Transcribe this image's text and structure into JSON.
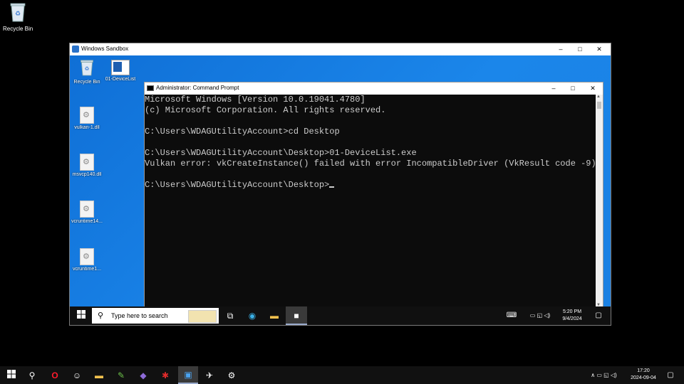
{
  "host_desktop": {
    "recycle_bin_label": "Recycle Bin"
  },
  "sandbox": {
    "title": "Windows Sandbox",
    "minimize": "–",
    "maximize": "□",
    "close": "✕",
    "icons": [
      "Recycle Bin",
      "01-DeviceList",
      "vulkan-1.dll",
      "msvcp140.dll",
      "vcruntime14...",
      "vcruntime1..."
    ]
  },
  "cmd": {
    "title": "Administrator: Command Prompt",
    "lines": [
      "Microsoft Windows [Version 10.0.19041.4780]",
      "(c) Microsoft Corporation. All rights reserved.",
      "",
      "C:\\Users\\WDAGUtilityAccount>cd Desktop",
      "",
      "C:\\Users\\WDAGUtilityAccount\\Desktop>01-DeviceList.exe",
      "Vulkan error: vkCreateInstance() failed with error IncompatibleDriver (VkResult code -9).",
      "",
      "C:\\Users\\WDAGUtilityAccount\\Desktop>"
    ]
  },
  "sandbox_taskbar": {
    "search_placeholder": "Type here to search",
    "time": "5:20 PM",
    "date": "9/4/2024"
  },
  "host_taskbar": {
    "time": "17:20",
    "date": "2024-09-04"
  }
}
